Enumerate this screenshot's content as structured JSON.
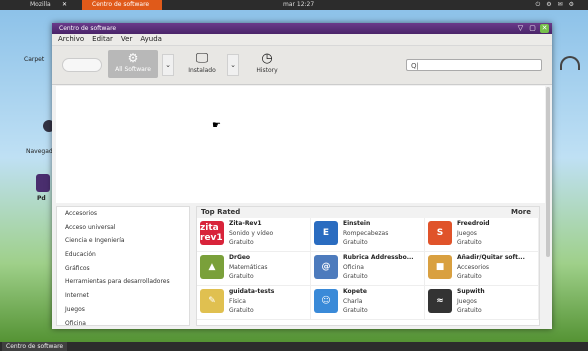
{
  "desktop": {
    "top_panel": {
      "app1": "Mozilla",
      "app2": "Centro de software",
      "clock": "mar 12:27"
    },
    "icons": {
      "carpeta": "Carpet",
      "navegador": "Navegad",
      "pd": "Pd"
    },
    "taskbar": {
      "task": "Centro de software"
    }
  },
  "window": {
    "title": "Centro de software",
    "menu": [
      "Archivo",
      "Editar",
      "Ver",
      "Ayuda"
    ],
    "toolbar": {
      "all_label": "All Software",
      "installed_label": "Instalado",
      "history_label": "History",
      "search_value": "Q|"
    },
    "categories": [
      "Accesorios",
      "Acceso universal",
      "Ciencia e Ingeniería",
      "Educación",
      "Gráficos",
      "Herramientas para desarrolladores",
      "Internet",
      "Juegos",
      "Oficina"
    ],
    "top_rated": {
      "heading": "Top Rated",
      "more": "More",
      "apps": [
        {
          "name": "Zita-Rev1",
          "category": "Sonido y vídeo",
          "price": "Gratuito",
          "icon": "zita-icon",
          "icon_text": "zita rev1",
          "color": "#d8233a"
        },
        {
          "name": "Einstein",
          "category": "Rompecabezas",
          "price": "Gratuito",
          "icon": "einstein-icon",
          "icon_text": "E",
          "color": "#2a6cc0"
        },
        {
          "name": "Freedroid",
          "category": "Juegos",
          "price": "Gratuito",
          "icon": "freedroid-icon",
          "icon_text": "S",
          "color": "#e0532a"
        },
        {
          "name": "DrGeo",
          "category": "Matemáticas",
          "price": "Gratuito",
          "icon": "drgeo-icon",
          "icon_text": "▲",
          "color": "#7aa03a"
        },
        {
          "name": "Rubrica Addressbo...",
          "category": "Oficina",
          "price": "Gratuito",
          "icon": "addressbook-icon",
          "icon_text": "@",
          "color": "#4d7bbd"
        },
        {
          "name": "Añadir/Quitar soft...",
          "category": "Accesorios",
          "price": "Gratuito",
          "icon": "package-icon",
          "icon_text": "■",
          "color": "#d9a040"
        },
        {
          "name": "guidata-tests",
          "category": "Física",
          "price": "Gratuito",
          "icon": "guidata-icon",
          "icon_text": "✎",
          "color": "#e0c050"
        },
        {
          "name": "Kopete",
          "category": "Charla",
          "price": "Gratuito",
          "icon": "kopete-icon",
          "icon_text": "☺",
          "color": "#3a8ad8"
        },
        {
          "name": "Supwith",
          "category": "Juegos",
          "price": "Gratuito",
          "icon": "supwith-icon",
          "icon_text": "≈",
          "color": "#333333"
        }
      ]
    }
  }
}
